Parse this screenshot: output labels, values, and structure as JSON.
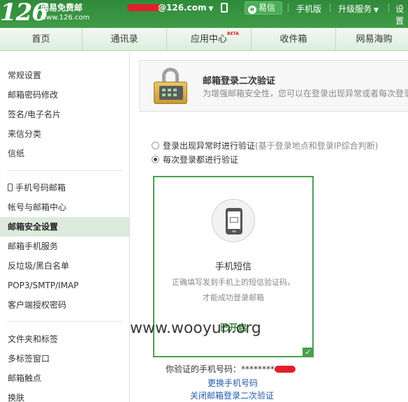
{
  "header": {
    "logo": "126",
    "brand_name": "网易免费邮",
    "brand_url": "www.126.com",
    "account": "@126.com",
    "yixin": "易信",
    "mobile": "手机版",
    "upgrade": "升级服务",
    "settings": "设置",
    "accent_color": "#3a9a44"
  },
  "nav": {
    "tabs": [
      "首页",
      "通讯录",
      "应用中心",
      "收件箱",
      "网易海购"
    ],
    "beta": "BETA"
  },
  "sidebar": {
    "items": [
      "常规设置",
      "邮箱密码修改",
      "签名/电子名片",
      "来信分类",
      "信纸",
      "手机号码邮箱",
      "帐号与邮箱中心",
      "邮箱安全设置",
      "邮箱手机服务",
      "反垃圾/黑白名单",
      "POP3/SMTP/IMAP",
      "客户端授权密码",
      "文件夹和标签",
      "多标签窗口",
      "邮箱触点",
      "换肤"
    ],
    "active": "邮箱安全设置"
  },
  "panel": {
    "title": "邮箱登录二次验证",
    "desc": "为增强邮箱安全性，您可以在登录出现异常或者每次登录"
  },
  "options": {
    "opt1": "登录出现异常时进行验证",
    "opt1_hint": "(基于登录地点和登录IP综合判断)",
    "opt2": "每次登录都进行验证",
    "selected": 2
  },
  "card": {
    "title": "手机短信",
    "desc": "正确填写发到手机上的短信验证码，才能成功登录邮箱",
    "status": "已开启"
  },
  "footer": {
    "verified_label": "你验证的手机号码：",
    "masked": "********",
    "change_link": "更换手机号码",
    "close_link": "关闭邮箱登录二次验证"
  },
  "watermark": "www.wooyun.org"
}
